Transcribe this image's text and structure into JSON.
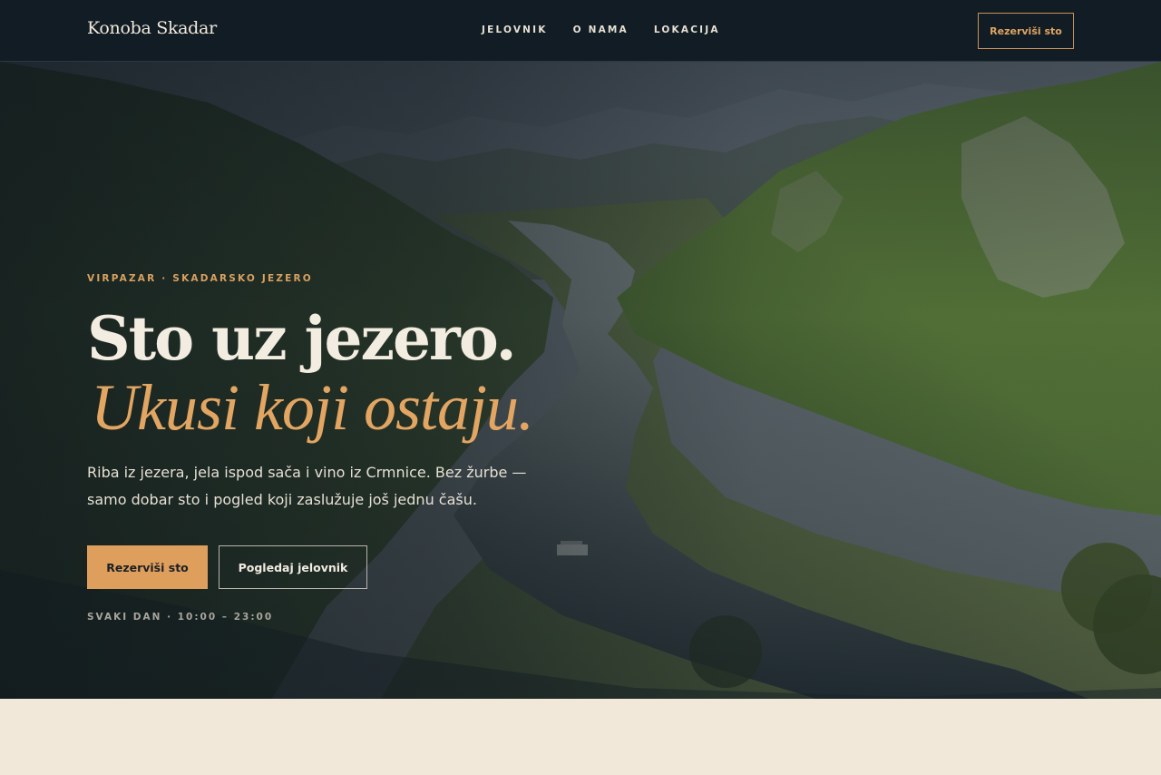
{
  "brand": {
    "name": "Konoba Skadar"
  },
  "nav": {
    "links": [
      {
        "label": "JELOVNIK"
      },
      {
        "label": "O NAMA"
      },
      {
        "label": "LOKACIJA"
      }
    ],
    "cta_label": "Rezerviši sto"
  },
  "hero": {
    "eyebrow": "VIRPAZAR · SKADARSKO JEZERO",
    "headline": "Sto uz jezero.",
    "headline_accent": "Ukusi koji ostaju.",
    "lede": "Riba iz jezera, jela ispod sača i vino iz Crmnice. Bez žurbe — samo dobar sto i pogled koji zaslužuje još jednu čašu.",
    "primary_button": "Rezerviši sto",
    "secondary_button": "Pogledaj jelovnik",
    "hours": "SVAKI DAN · 10:00 – 23:00"
  },
  "colors": {
    "nav_bg": "#111c24",
    "accent": "#df9f5c",
    "cream": "#f1e8da",
    "headline": "#f3ece0"
  }
}
